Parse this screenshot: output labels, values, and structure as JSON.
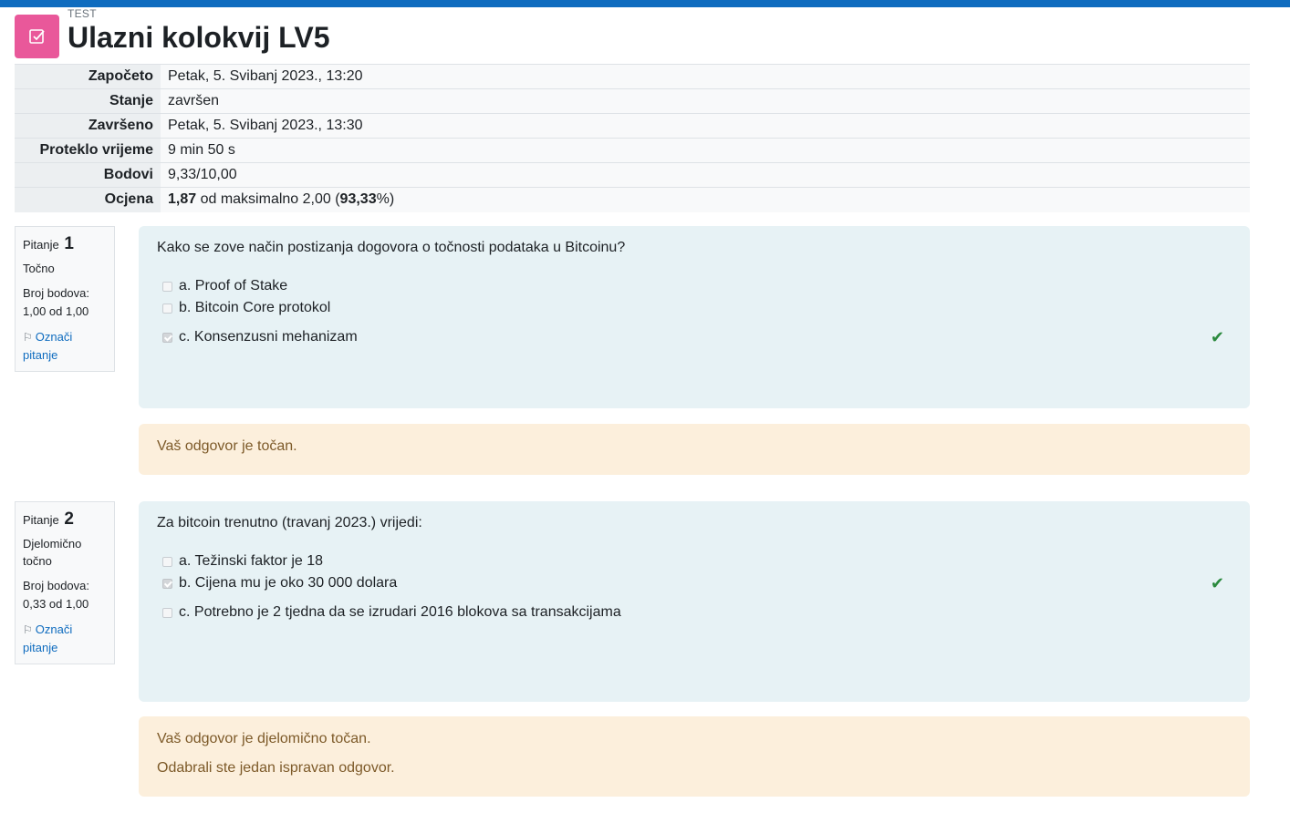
{
  "colors": {
    "topbar": "#0f6cbf",
    "icon_bg": "#e9589a",
    "formulation_bg": "#e7f2f5",
    "feedback_bg": "#fcefdc",
    "correct": "#2b8a3e"
  },
  "header": {
    "preheader": "TEST",
    "title": "Ulazni kolokvij LV5",
    "icon": "quiz-checkbox-icon"
  },
  "summary": {
    "rows": [
      {
        "label": "Započeto",
        "value": "Petak, 5. Svibanj 2023., 13:20"
      },
      {
        "label": "Stanje",
        "value": "završen"
      },
      {
        "label": "Završeno",
        "value": "Petak, 5. Svibanj 2023., 13:30"
      },
      {
        "label": "Proteklo vrijeme",
        "value": "9 min 50 s"
      },
      {
        "label": "Bodovi",
        "value": "9,33/10,00"
      }
    ],
    "grade": {
      "label": "Ocjena",
      "score": "1,87",
      "middle": " od maksimalno 2,00 (",
      "percent": "93,33",
      "suffix": "%)"
    }
  },
  "questions": [
    {
      "label": "Pitanje",
      "number": "1",
      "state": "Točno",
      "grade_label": "Broj bodova:",
      "grade_value": "1,00 od 1,00",
      "flag_label": "Označi pitanje",
      "text": "Kako se zove način postizanja dogovora o točnosti podataka u Bitcoinu?",
      "answers": [
        {
          "text": "a. Proof of Stake",
          "checked": false,
          "correct": false
        },
        {
          "text": "b. Bitcoin Core protokol",
          "checked": false,
          "correct": false
        },
        {
          "text": "c. Konsenzusni mehanizam",
          "checked": true,
          "correct": true
        }
      ],
      "feedback": [
        "Vaš odgovor je točan."
      ]
    },
    {
      "label": "Pitanje",
      "number": "2",
      "state": "Djelomično točno",
      "grade_label": "Broj bodova:",
      "grade_value": "0,33 od 1,00",
      "flag_label": "Označi pitanje",
      "text": "Za bitcoin trenutno (travanj 2023.) vrijedi:",
      "answers": [
        {
          "text": "a. Težinski faktor je 18",
          "checked": false,
          "correct": false
        },
        {
          "text": "b. Cijena mu je oko 30 000 dolara",
          "checked": true,
          "correct": true
        },
        {
          "text": "c. Potrebno je 2 tjedna da se izrudari 2016 blokova sa transakcijama",
          "checked": false,
          "correct": false
        }
      ],
      "feedback": [
        "Vaš odgovor je djelomično točan.",
        "Odabrali ste jedan ispravan odgovor."
      ]
    }
  ]
}
